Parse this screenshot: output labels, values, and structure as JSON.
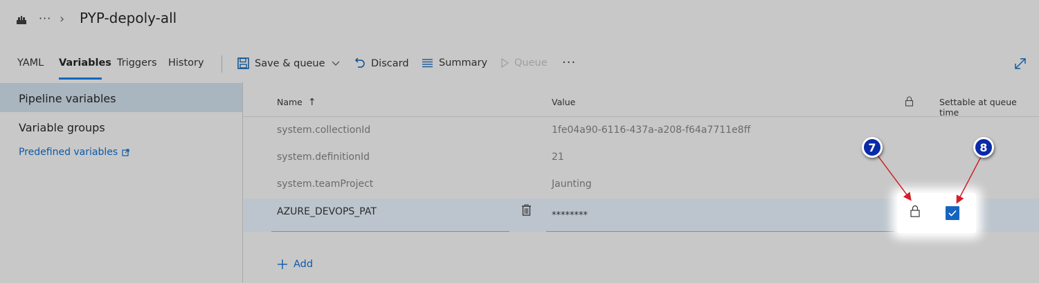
{
  "header": {
    "pipeline_icon": "pipeline-icon",
    "more_label": "···",
    "chevron": "›",
    "title": "PYP-depoly-all"
  },
  "tabs": [
    {
      "label": "YAML",
      "active": false
    },
    {
      "label": "Variables",
      "active": true
    },
    {
      "label": "Triggers",
      "active": false
    },
    {
      "label": "History",
      "active": false
    }
  ],
  "toolbar": {
    "save_queue": "Save & queue",
    "discard": "Discard",
    "summary": "Summary",
    "queue": "Queue",
    "more": "···"
  },
  "sidebar": {
    "items": [
      {
        "label": "Pipeline variables",
        "selected": true
      },
      {
        "label": "Variable groups",
        "selected": false
      }
    ],
    "link": "Predefined variables"
  },
  "table": {
    "columns": {
      "name": "Name",
      "name_sort": "↑",
      "value": "Value",
      "settable": "Settable at queue time"
    },
    "rows": [
      {
        "name": "system.collectionId",
        "value": "1fe04a90-6116-437a-a208-f64a7711e8ff"
      },
      {
        "name": "system.definitionId",
        "value": "21"
      },
      {
        "name": "system.teamProject",
        "value": "Jaunting"
      }
    ],
    "editable_row": {
      "name": "AZURE_DEVOPS_PAT",
      "value": "********",
      "secret_locked": false,
      "settable_checked": true
    },
    "add_label": "Add"
  },
  "callouts": [
    "7",
    "8"
  ],
  "colors": {
    "accent": "#0b68b9",
    "link": "#0b5aa8",
    "callout": "#0a2aa8",
    "arrow": "#d0202a",
    "checkbox": "#1565c0"
  }
}
